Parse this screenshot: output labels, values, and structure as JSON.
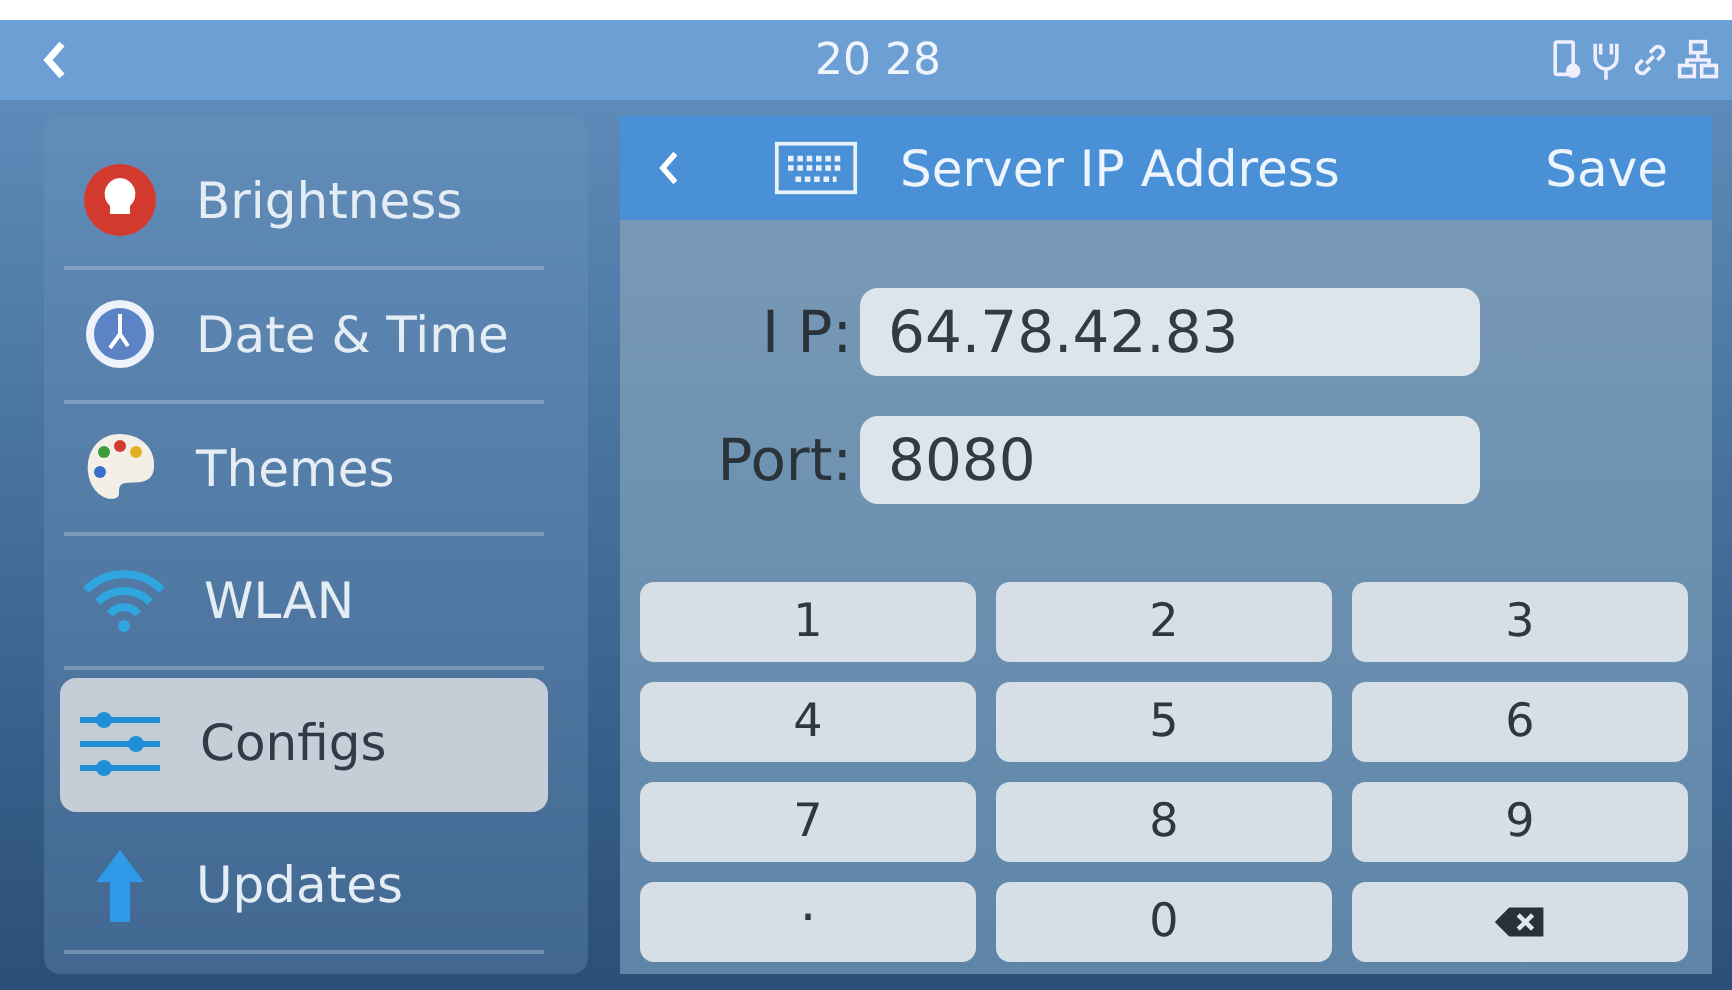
{
  "status_bar": {
    "time": "20 28"
  },
  "sidebar": {
    "items": [
      {
        "label": "Brightness",
        "kind": "brightness",
        "selected": false
      },
      {
        "label": "Date & Time",
        "kind": "clock",
        "selected": false
      },
      {
        "label": "Themes",
        "kind": "palette",
        "selected": false
      },
      {
        "label": "WLAN",
        "kind": "wifi",
        "selected": false
      },
      {
        "label": "Configs",
        "kind": "sliders",
        "selected": true
      },
      {
        "label": "Updates",
        "kind": "update",
        "selected": false
      }
    ]
  },
  "panel": {
    "title": "Server IP Address",
    "save": "Save",
    "fields": [
      {
        "label": "I P:",
        "value": "64.78.42.83"
      },
      {
        "label": "Port:",
        "value": "8080"
      }
    ],
    "keys": [
      {
        "kind": "digit",
        "label": "1"
      },
      {
        "kind": "digit",
        "label": "2"
      },
      {
        "kind": "digit",
        "label": "3"
      },
      {
        "kind": "digit",
        "label": "4"
      },
      {
        "kind": "digit",
        "label": "5"
      },
      {
        "kind": "digit",
        "label": "6"
      },
      {
        "kind": "digit",
        "label": "7"
      },
      {
        "kind": "digit",
        "label": "8"
      },
      {
        "kind": "digit",
        "label": "9"
      },
      {
        "kind": "point",
        "label": "."
      },
      {
        "kind": "digit",
        "label": "0"
      },
      {
        "kind": "backspace"
      }
    ]
  }
}
